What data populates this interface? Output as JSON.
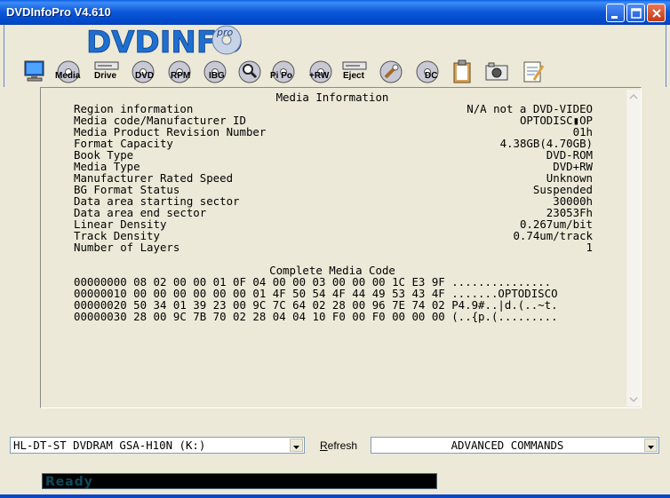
{
  "window": {
    "title": "DVDInfoPro V4.610"
  },
  "logo": {
    "text": "DVDINFO",
    "badge": "pro"
  },
  "toolbar": {
    "media": "Media",
    "drive": "Drive",
    "dvd": "DVD",
    "rpm": "RPM",
    "ibg": "IBG",
    "pipo": "Pi Po",
    "rw": "+RW",
    "eject": "Eject",
    "dc": "DC"
  },
  "media_info": {
    "title": "Media Information",
    "rows": [
      {
        "label": "Region information",
        "value": "N/A not a DVD-VIDEO"
      },
      {
        "label": "Media code/Manufacturer ID",
        "value": "OPTODISC▮OP"
      },
      {
        "label": "Media Product Revision Number",
        "value": "01h"
      },
      {
        "label": "Format Capacity",
        "value": "4.38GB(4.70GB)"
      },
      {
        "label": "Book Type",
        "value": "DVD-ROM"
      },
      {
        "label": "Media Type",
        "value": "DVD+RW"
      },
      {
        "label": "Manufacturer Rated Speed",
        "value": "Unknown"
      },
      {
        "label": "BG Format Status",
        "value": "Suspended"
      },
      {
        "label": "Data area starting sector",
        "value": "30000h"
      },
      {
        "label": "Data area end sector",
        "value": "23053Fh"
      },
      {
        "label": "Linear Density",
        "value": "0.267um/bit"
      },
      {
        "label": "Track Density",
        "value": "0.74um/track"
      },
      {
        "label": "Number of Layers",
        "value": "1"
      }
    ]
  },
  "media_code": {
    "title": "Complete Media Code",
    "rows": [
      "00000000 08 02 00 00 01 0F 04 00 00 03 00 00 00 1C E3 9F ...............",
      "00000010 00 00 00 00 00 00 01 4F 50 54 4F 44 49 53 43 4F .......OPTODISCO",
      "00000020 50 34 01 39 23 00 9C 7C 64 02 28 00 96 7E 74 02 P4.9#..|d.(..~t.",
      "00000030 28 00 9C 7B 70 02 28 04 04 10 F0 00 F0 00 00 00 (..{p.(........."
    ]
  },
  "drive_select": {
    "value": "HL-DT-ST DVDRAM GSA-H10N (K:)"
  },
  "refresh": {
    "accel": "R",
    "rest": "efresh"
  },
  "advanced": {
    "value": "ADVANCED COMMANDS"
  },
  "status": {
    "text": "Ready"
  }
}
